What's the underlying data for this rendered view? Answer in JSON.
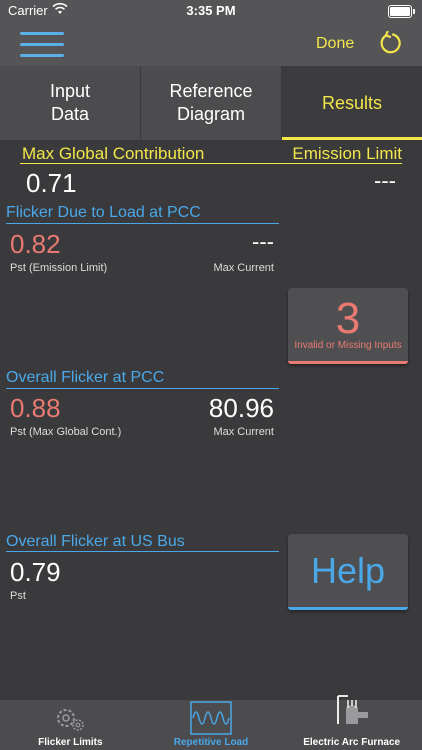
{
  "status": {
    "carrier": "Carrier",
    "time": "3:35 PM"
  },
  "nav": {
    "done_label": "Done"
  },
  "tabs": [
    {
      "line1": "Input",
      "line2": "Data"
    },
    {
      "line1": "Reference",
      "line2": "Diagram"
    },
    {
      "line1": "Results",
      "line2": ""
    }
  ],
  "header": {
    "left_title": "Max Global Contribution",
    "right_title": "Emission Limit",
    "left_value": "0.71",
    "right_value": "---"
  },
  "load_pcc": {
    "title": "Flicker Due to Load at PCC",
    "pst_value": "0.82",
    "pst_label": "Pst (Emission Limit)",
    "current_value": "---",
    "current_label": "Max Current"
  },
  "invalid_card": {
    "count": "3",
    "label": "Invalid or Missing Inputs"
  },
  "overall_pcc": {
    "title": "Overall Flicker at PCC",
    "pst_value": "0.88",
    "pst_label": "Pst (Max Global Cont.)",
    "current_value": "80.96",
    "current_label": "Max Current"
  },
  "overall_us": {
    "title": "Overall Flicker at US Bus",
    "pst_value": "0.79",
    "pst_label": "Pst"
  },
  "help_card": {
    "label": "Help"
  },
  "tabbar": [
    {
      "label": "Flicker Limits",
      "icon": "gears-icon"
    },
    {
      "label": "Repetitive Load",
      "icon": "waveform-icon"
    },
    {
      "label": "Electric Arc Furnace",
      "icon": "furnace-icon"
    }
  ],
  "colors": {
    "accent_yellow": "#f2e64a",
    "accent_blue": "#4aa8e8",
    "alert_red": "#e87a72"
  }
}
